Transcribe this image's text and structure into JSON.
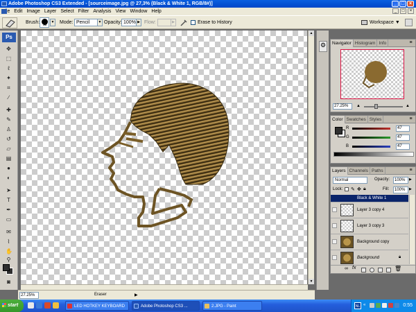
{
  "window": {
    "title": "Adobe Photoshop CS3 Extended - [sourceimage.jpg @ 27,3% (Black & White 1, RGB/8#)]",
    "controls": [
      "_",
      "□",
      "×"
    ]
  },
  "menu": [
    "File",
    "Edit",
    "Image",
    "Layer",
    "Select",
    "Filter",
    "Analysis",
    "View",
    "Window",
    "Help"
  ],
  "options_bar": {
    "brush_label": "Brush:",
    "brush_size": "13",
    "mode_label": "Mode:",
    "mode_value": "Pencil",
    "opacity_label": "Opacity:",
    "opacity_value": "100%",
    "flow_label": "Flow:",
    "flow_value": "",
    "erase_history_label": "Erase to History",
    "erase_history_checked": false,
    "workspace_label": "Workspace"
  },
  "toolbox": {
    "logo": "Ps",
    "tools": [
      "move-tool",
      "marquee-tool",
      "lasso-tool",
      "magic-wand-tool",
      "crop-tool",
      "slice-tool",
      "healing-brush-tool",
      "brush-tool",
      "clone-stamp-tool",
      "history-brush-tool",
      "eraser-tool",
      "gradient-tool",
      "blur-tool",
      "dodge-tool",
      "path-selection-tool",
      "type-tool",
      "pen-tool",
      "shape-tool",
      "notes-tool",
      "eyedropper-tool",
      "hand-tool",
      "zoom-tool"
    ],
    "foreground_color": "#2f2f2f",
    "background_color": "#2f2f2f"
  },
  "status_bar": {
    "zoom": "27.25%",
    "tool": "Eraser"
  },
  "navigator_panel": {
    "tabs": [
      "Navigator",
      "Histogram",
      "Info"
    ],
    "active_tab": "Navigator",
    "zoom_value": "27.25%"
  },
  "color_panel": {
    "tabs": [
      "Color",
      "Swatches",
      "Styles"
    ],
    "active_tab": "Color",
    "channels": [
      {
        "label": "R",
        "value": "47",
        "color": "#c0302a"
      },
      {
        "label": "G",
        "value": "47",
        "color": "#2a9a2a"
      },
      {
        "label": "B",
        "value": "47",
        "color": "#2a40c0"
      }
    ]
  },
  "layers_panel": {
    "tabs": [
      "Layers",
      "Channels",
      "Paths"
    ],
    "active_tab": "Layers",
    "blend_mode": "Normal",
    "opacity_label": "Opacity:",
    "opacity_value": "100%",
    "lock_label": "Lock:",
    "fill_label": "Fill:",
    "fill_value": "100%",
    "layers": [
      {
        "name": "Black & White 1",
        "selected": true,
        "thumb": "adjustment"
      },
      {
        "name": "Layer 3 copy 4",
        "selected": false,
        "thumb": "transparent"
      },
      {
        "name": "Layer 3 copy 3",
        "selected": false,
        "thumb": "transparent"
      },
      {
        "name": "Background copy",
        "selected": false,
        "thumb": "bronze"
      },
      {
        "name": "Background",
        "selected": false,
        "thumb": "bronze",
        "locked": true
      }
    ]
  },
  "taskbar": {
    "start_label": "start",
    "tasks": [
      {
        "label": "LED HOTKEY KEYBOARD",
        "active": false
      },
      {
        "label": "Adobe Photoshop CS3 ...",
        "active": true
      },
      {
        "label": "2.JPG - Paint",
        "active": false
      }
    ],
    "tray_lang": "NL",
    "clock": "0:55"
  },
  "colors": {
    "titlebar": "#0a5fe0",
    "chrome": "#ece9d8",
    "workspace_bg": "#6b6b6b",
    "selection": "#0a246a",
    "bronze": "#8a6a30"
  }
}
